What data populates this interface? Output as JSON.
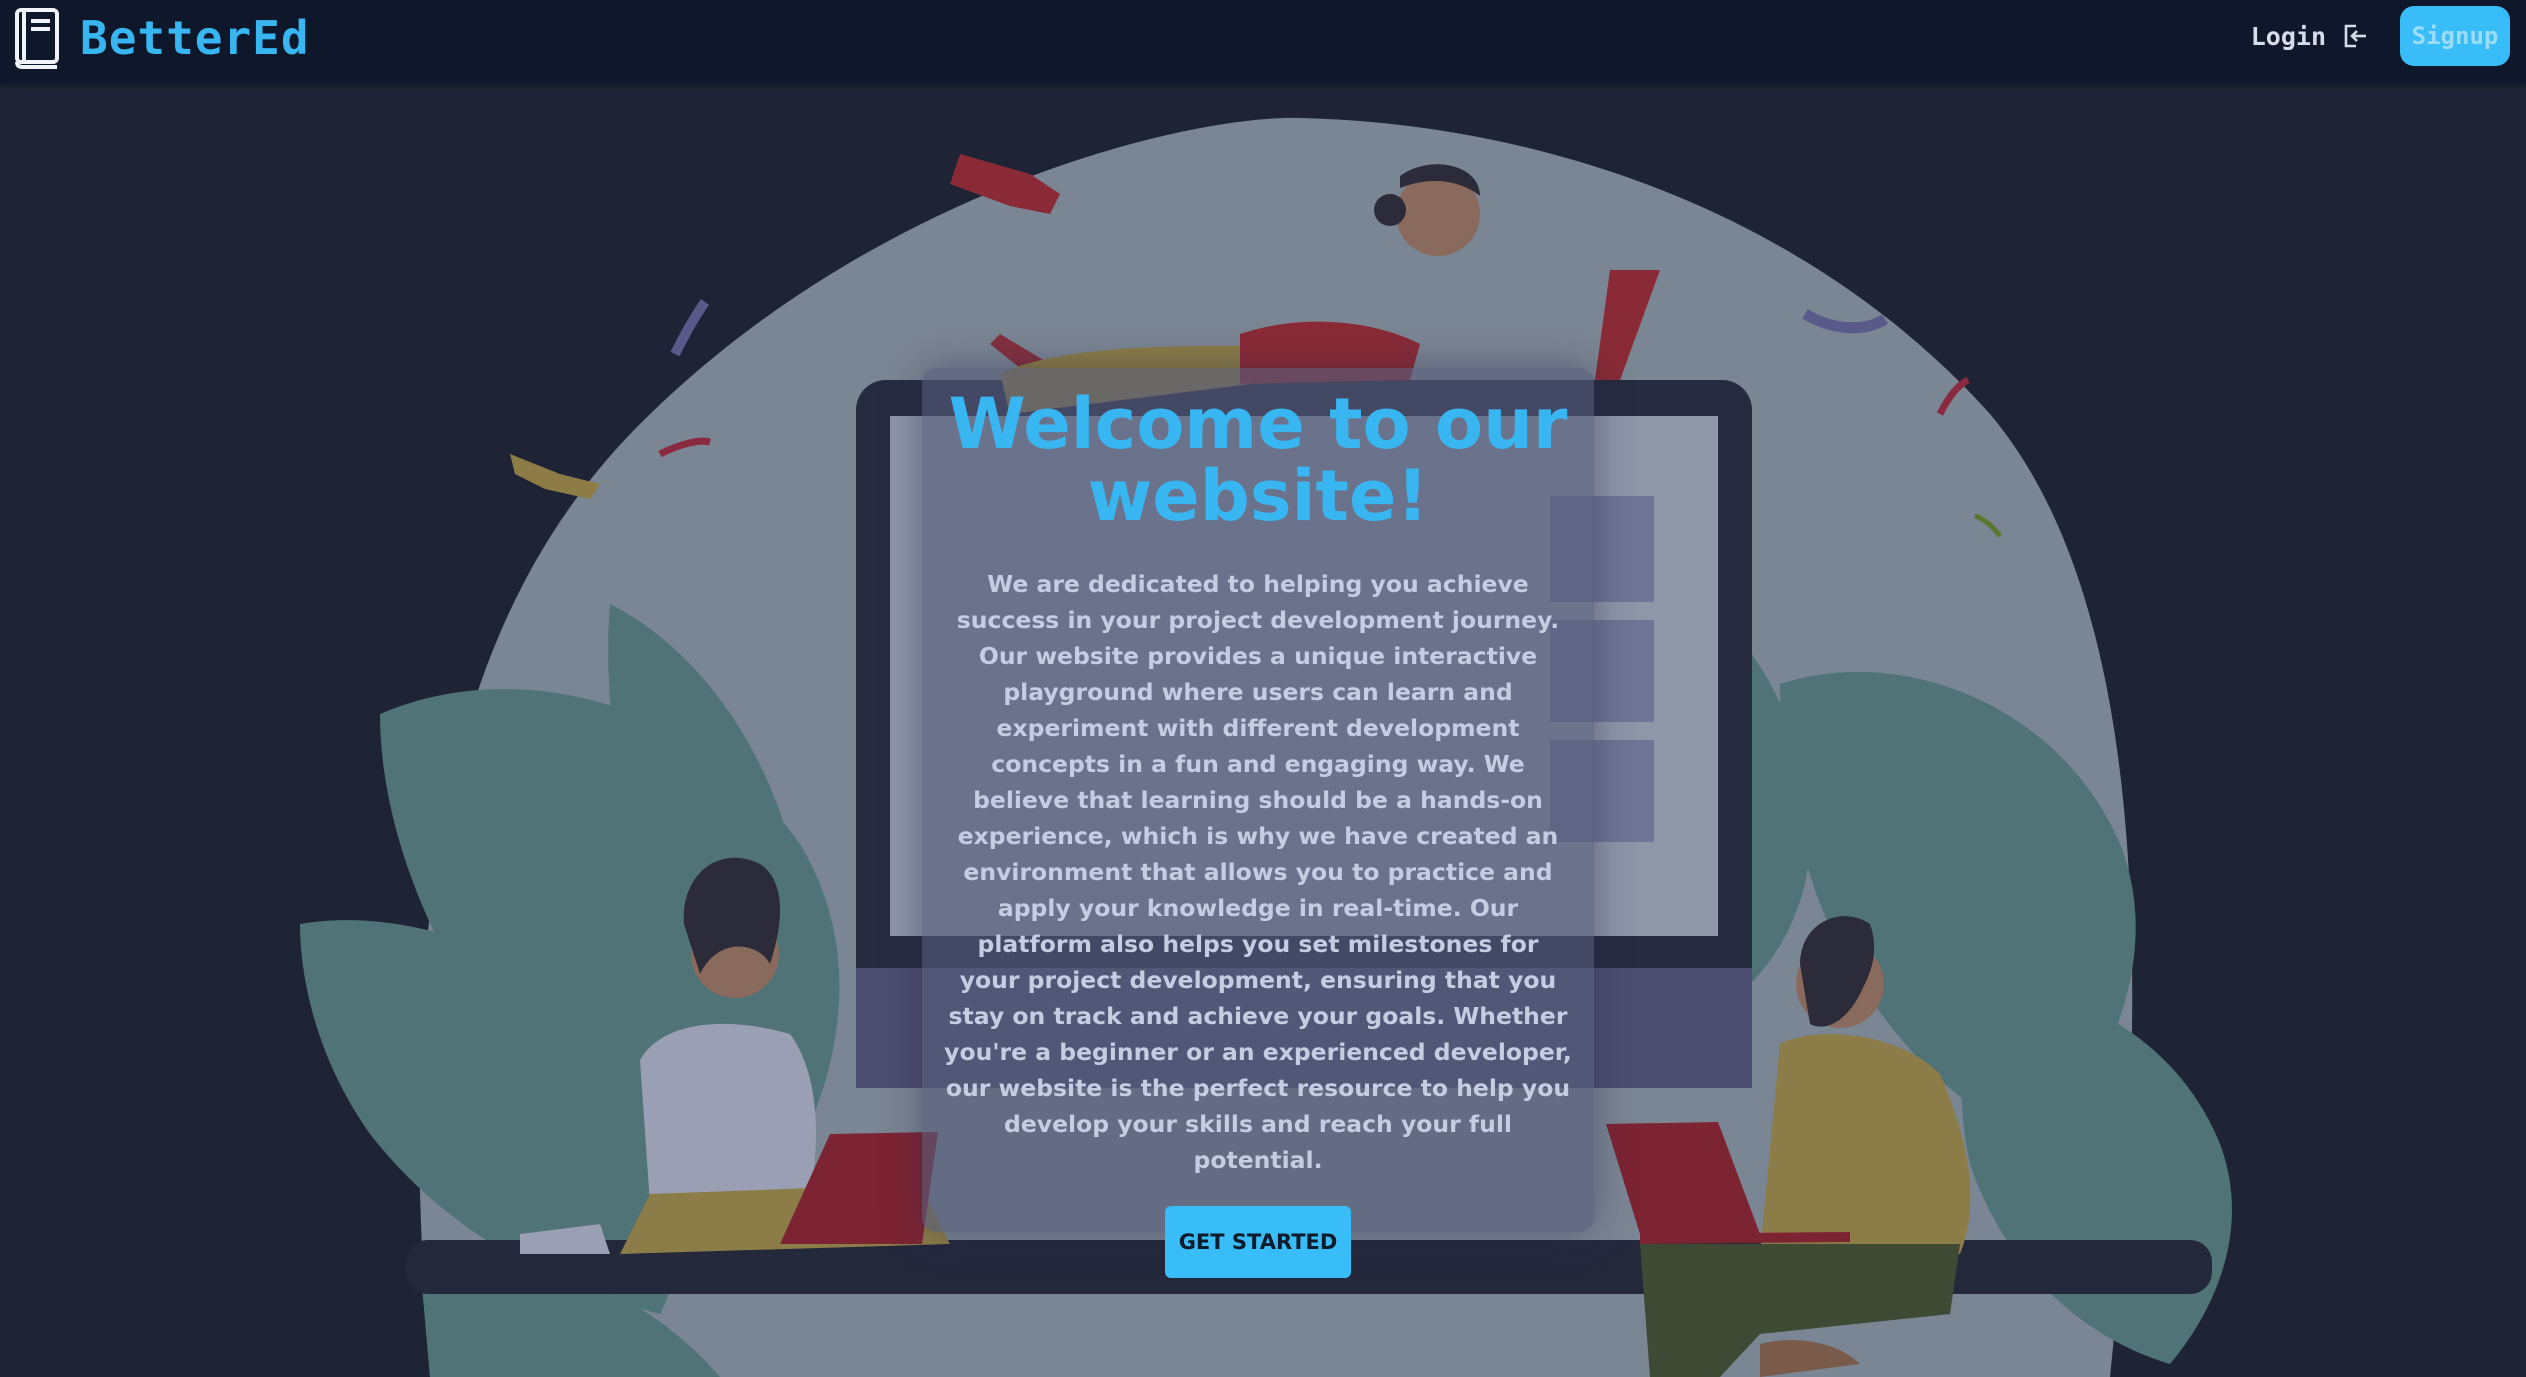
{
  "brand": {
    "name": "BetterEd",
    "logo_icon": "book-icon"
  },
  "nav": {
    "login_label": "Login",
    "login_icon": "sign-in-icon",
    "signup_label": "Signup"
  },
  "hero": {
    "illustration": "people-working-on-laptops-illustration",
    "title": "Welcome to our website!",
    "body": "We are dedicated to helping you achieve success in your project development journey. Our website provides a unique interactive playground where users can learn and experiment with different development concepts in a fun and engaging way. We believe that learning should be a hands-on experience, which is why we have created an environment that allows you to practice and apply your knowledge in real-time. Our platform also helps you set milestones for your project development, ensuring that you stay on track and achieve your goals. Whether you're a beginner or an experienced developer, our website is the perfect resource to help you develop your skills and reach your full potential.",
    "cta_label": "GET STARTED"
  },
  "colors": {
    "navbar_bg": "#0f172a",
    "page_bg": "#1e2435",
    "accent": "#38bdf8",
    "body_text": "#c5cde2"
  }
}
